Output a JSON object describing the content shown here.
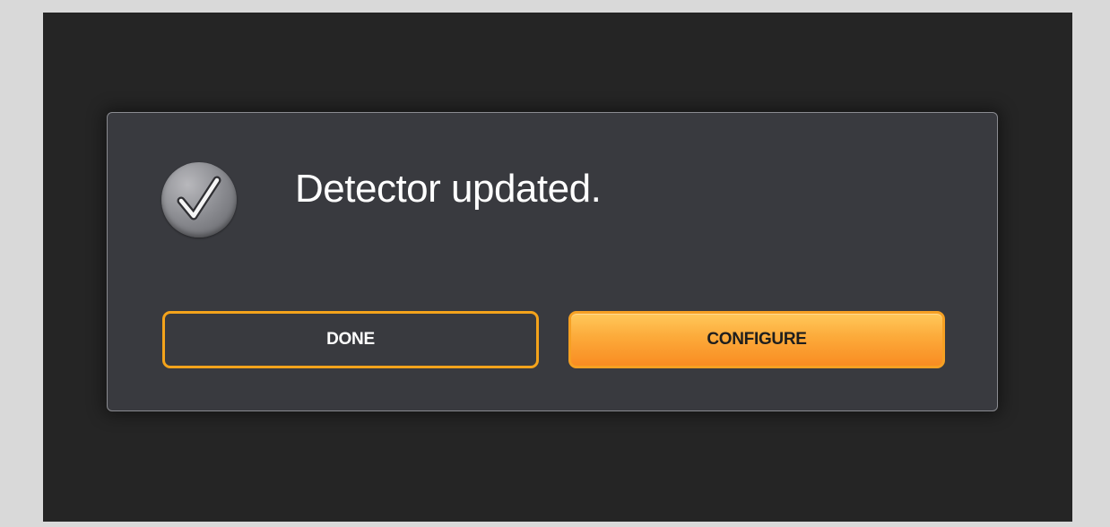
{
  "dialog": {
    "message": "Detector updated.",
    "icon": "checkmark-circle-icon",
    "buttons": {
      "done_label": "DONE",
      "configure_label": "CONFIGURE"
    }
  },
  "colors": {
    "accent": "#f4a31b",
    "primary_button_top": "#ffc85a",
    "primary_button_bottom": "#f98c22",
    "dialog_background": "#393a3f",
    "app_background": "#252525"
  }
}
